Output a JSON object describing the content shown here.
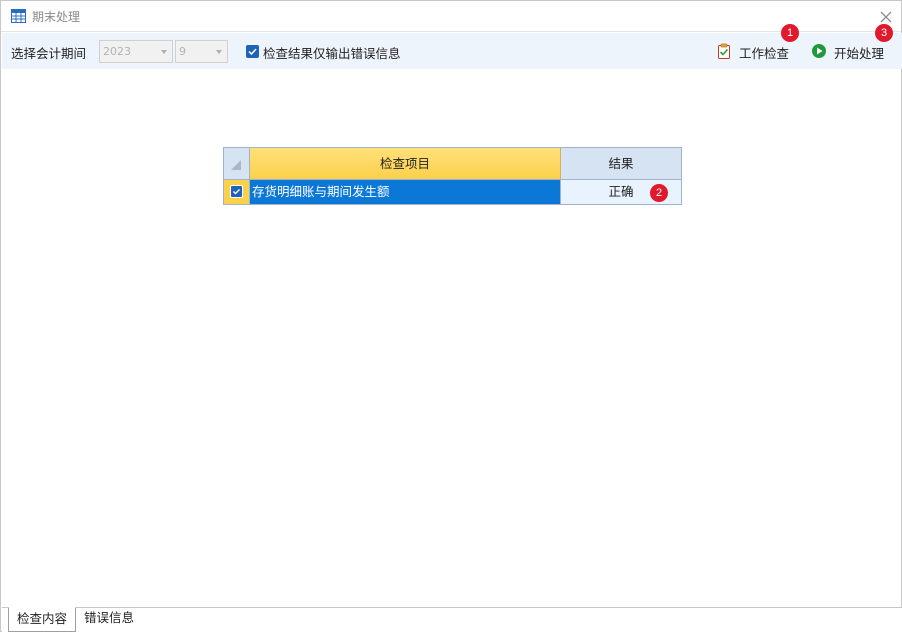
{
  "window": {
    "title": "期末处理"
  },
  "toolbar": {
    "period_label": "选择会计期间",
    "year_value": "2023",
    "month_value": "9",
    "errors_only_label": "检查结果仅输出错误信息",
    "errors_only_checked": true,
    "work_check_label": "工作检查",
    "start_label": "开始处理"
  },
  "grid": {
    "columns": [
      "检查项目",
      "结果"
    ],
    "rows": [
      {
        "checked": true,
        "item": "存货明细账与期间发生额",
        "result": "正确"
      }
    ]
  },
  "badges": [
    "1",
    "2",
    "3"
  ],
  "tabs": [
    "检查内容",
    "错误信息"
  ],
  "colors": {
    "accent": "#1f63b9",
    "selection": "#0b78d7",
    "header_highlight": "#fbd04a",
    "badge": "#e0192d",
    "toolbar_bg": "#eef4fb"
  }
}
